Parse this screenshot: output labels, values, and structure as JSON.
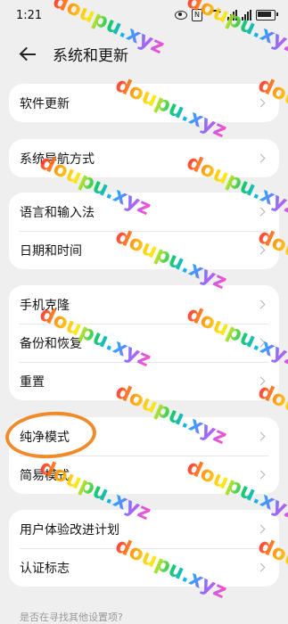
{
  "status_bar": {
    "time": "1:21",
    "signal_label_1": "4G",
    "signal_label_2": "4G"
  },
  "header": {
    "title": "系统和更新"
  },
  "cards": [
    {
      "items": [
        {
          "label": "软件更新"
        }
      ]
    },
    {
      "items": [
        {
          "label": "系统导航方式"
        }
      ]
    },
    {
      "items": [
        {
          "label": "语言和输入法"
        },
        {
          "label": "日期和时间"
        }
      ]
    },
    {
      "items": [
        {
          "label": "手机克隆"
        },
        {
          "label": "备份和恢复"
        },
        {
          "label": "重置"
        }
      ]
    },
    {
      "items": [
        {
          "label": "纯净模式"
        },
        {
          "label": "简易模式"
        }
      ]
    },
    {
      "items": [
        {
          "label": "用户体验改进计划"
        },
        {
          "label": "认证标志"
        }
      ]
    }
  ],
  "footer": {
    "hint": "是否在寻找其他设置项?"
  },
  "watermark": {
    "text": "doupu.xyz"
  }
}
